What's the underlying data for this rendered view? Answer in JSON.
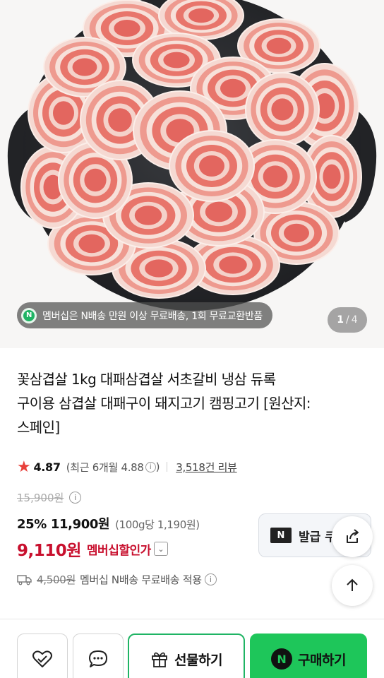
{
  "gallery": {
    "image_alt": "sliced pork belly rolls on a round black grill pan",
    "member_banner": "멤버십은 N배송 만원 이상 무료배송, 1회 무료교환반품",
    "member_badge": "N",
    "pager_current": "1",
    "pager_separator": "/",
    "pager_total": "4"
  },
  "product": {
    "title_line1": "꽃삼겹살 1kg 대패삼겹살 서초갈비 냉삼 듀록",
    "title_line2": "구이용 삼겹살 대패구이 돼지고기 캠핑고기 [원산지:",
    "title_line3": "스페인]"
  },
  "rating": {
    "star": "★",
    "score": "4.87",
    "recent": "(최근 6개월 4.88",
    "recent_close": ")",
    "info": "i",
    "review_count": "3,518건 리뷰"
  },
  "price": {
    "original": "15,900원",
    "discount_pct": "25%",
    "sale": "11,900원",
    "unit_price": "(100g당 1,190원)",
    "member_price": "9,110원",
    "member_label": "멤버십할인가",
    "chevron": "⌄"
  },
  "coupon": {
    "logo": "N",
    "label": "발급 쿠"
  },
  "shipping": {
    "fee": "4,500원",
    "text": "멤버십 N배송 무료배송 적용"
  },
  "bottom": {
    "gift_label": "선물하기",
    "buy_logo": "N",
    "buy_label": "구매하기"
  },
  "colors": {
    "accent_green": "#1ec65a",
    "member_red": "#c8102e",
    "star_red": "#e8403a"
  },
  "icons": {
    "share": "share-icon",
    "top": "arrow-up-icon",
    "wish": "heart-check-icon",
    "chat": "chat-bubble-icon",
    "gift": "gift-icon",
    "truck": "truck-icon"
  }
}
